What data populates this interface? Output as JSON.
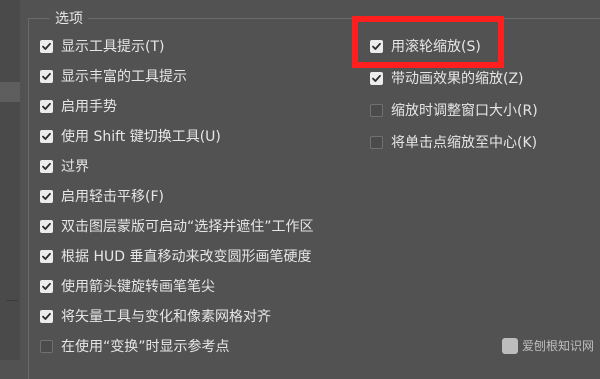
{
  "group_title": "选项",
  "left_options": [
    {
      "label": "显示工具提示(T)",
      "checked": true
    },
    {
      "label": "显示丰富的工具提示",
      "checked": true
    },
    {
      "label": "启用手势",
      "checked": true
    },
    {
      "label": "使用 Shift 键切换工具(U)",
      "checked": true
    },
    {
      "label": "过界",
      "checked": true
    },
    {
      "label": "启用轻击平移(F)",
      "checked": true
    },
    {
      "label": "双击图层蒙版可启动“选择并遮住”工作区",
      "checked": true
    },
    {
      "label": "根据 HUD 垂直移动来改变圆形画笔硬度",
      "checked": true
    },
    {
      "label": "使用箭头键旋转画笔笔尖",
      "checked": true
    },
    {
      "label": "将矢量工具与变化和像素网格对齐",
      "checked": true
    },
    {
      "label": "在使用“变换”时显示参考点",
      "checked": false
    }
  ],
  "right_options": [
    {
      "label": "用滚轮缩放(S)",
      "checked": true
    },
    {
      "label": "带动画效果的缩放(Z)",
      "checked": true
    },
    {
      "label": "缩放时调整窗口大小(R)",
      "checked": false
    },
    {
      "label": "将单击点缩放至中心(K)",
      "checked": false
    }
  ],
  "highlight_color": "#ff1f1f",
  "watermark": "爱刨根知识网"
}
